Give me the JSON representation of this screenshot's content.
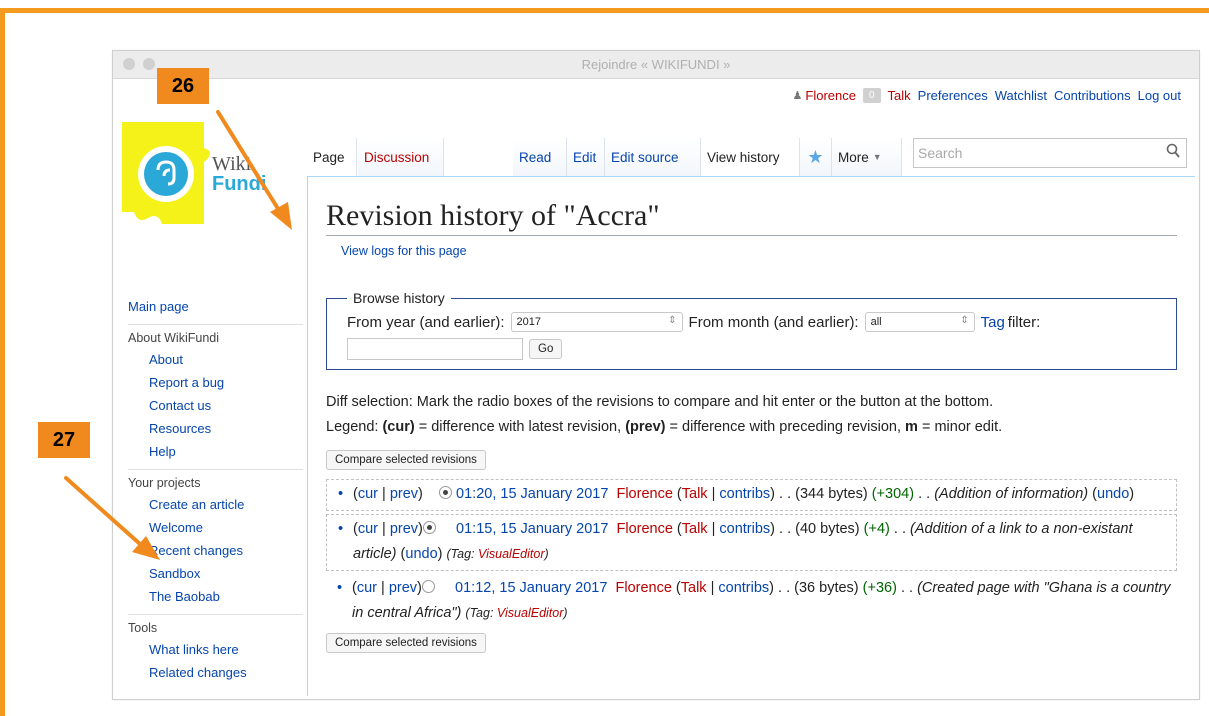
{
  "window": {
    "title": "Rejoindre « WIKIFUNDI »"
  },
  "badges": {
    "first": "26",
    "second": "27"
  },
  "personal": {
    "user": "Florence",
    "notifications": "0",
    "talk": "Talk",
    "preferences": "Preferences",
    "watchlist": "Watchlist",
    "contributions": "Contributions",
    "logout": "Log out"
  },
  "logo": {
    "line1": "Wiki",
    "line2": "Fundi"
  },
  "sidebar": {
    "main": "Main page",
    "about_head": "About WikiFundi",
    "about": [
      "About",
      "Report a bug",
      "Contact us",
      "Resources",
      "Help"
    ],
    "projects_head": "Your projects",
    "projects": [
      "Create an article",
      "Welcome",
      "Recent changes",
      "Sandbox",
      "The Baobab"
    ],
    "tools_head": "Tools",
    "tools": [
      "What links here",
      "Related changes"
    ]
  },
  "tabs": {
    "page": "Page",
    "discussion": "Discussion",
    "read": "Read",
    "edit": "Edit",
    "edit_source": "Edit source",
    "view_history": "View history",
    "more": "More",
    "search_placeholder": "Search"
  },
  "content": {
    "title": "Revision history of \"Accra\"",
    "view_logs": "View logs for this page",
    "browse_legend": "Browse history",
    "from_year_label": "From year (and earlier):",
    "year_value": "2017",
    "from_month_label": "From month (and earlier):",
    "month_value": "all",
    "tag_link": "Tag",
    "tag_label": "filter:",
    "go": "Go",
    "diff_info": "Diff selection: Mark the radio boxes of the revisions to compare and hit enter or the button at the bottom.",
    "legend_prefix": "Legend:",
    "legend_cur": "(cur)",
    "legend_mid": "= difference with latest revision,",
    "legend_prev": "(prev)",
    "legend_mid2": "= difference with preceding revision,",
    "legend_m": "m",
    "legend_end": "= minor edit.",
    "compare": "Compare selected revisions"
  },
  "revisions": [
    {
      "cur": "cur",
      "prev": "prev",
      "date": "01:20, 15 January 2017",
      "user": "Florence",
      "talk": "Talk",
      "contribs": "contribs",
      "bytes": "(344 bytes)",
      "diff": "(+304)",
      "comment": "(Addition of information)",
      "undo": "undo",
      "tag": ""
    },
    {
      "cur": "cur",
      "prev": "prev",
      "date": "01:15, 15 January 2017",
      "user": "Florence",
      "talk": "Talk",
      "contribs": "contribs",
      "bytes": "(40 bytes)",
      "diff": "(+4)",
      "comment": "(Addition of a link to a non-existant article)",
      "undo": "undo",
      "tag": "VisualEditor"
    },
    {
      "cur": "cur",
      "prev": "prev",
      "date": "01:12, 15 January 2017",
      "user": "Florence",
      "talk": "Talk",
      "contribs": "contribs",
      "bytes": "(36 bytes)",
      "diff": "(+36)",
      "comment": "(Created page with \"Ghana is a country in central Africa\")",
      "undo": "",
      "tag": "VisualEditor"
    }
  ],
  "colors": {
    "annotation": "#f08a1f",
    "link": "#0645ad",
    "redlink": "#ba0000"
  }
}
